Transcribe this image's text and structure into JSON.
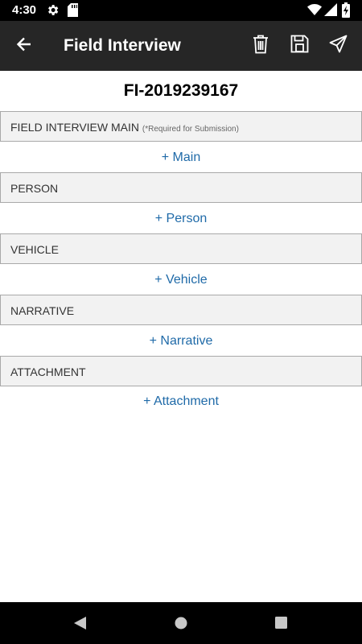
{
  "status_bar": {
    "time": "4:30",
    "icons": [
      "gear-icon",
      "sd-card-icon",
      "wifi-icon",
      "cellular-icon",
      "battery-charging-icon"
    ]
  },
  "app_bar": {
    "title": "Field Interview",
    "actions": [
      "back-arrow-icon",
      "delete-icon",
      "save-icon",
      "send-icon"
    ]
  },
  "record": {
    "id": "FI-2019239167"
  },
  "sections": [
    {
      "header": "FIELD INTERVIEW MAIN",
      "note": "(*Required for Submission)",
      "add_label": "+ Main"
    },
    {
      "header": "PERSON",
      "note": "",
      "add_label": "+ Person"
    },
    {
      "header": "VEHICLE",
      "note": "",
      "add_label": "+ Vehicle"
    },
    {
      "header": "NARRATIVE",
      "note": "",
      "add_label": "+ Narrative"
    },
    {
      "header": "ATTACHMENT",
      "note": "",
      "add_label": "+ Attachment"
    }
  ],
  "colors": {
    "status_bar": "#000000",
    "app_bar": "#262626",
    "link": "#1f6aa8",
    "section_bg": "#f2f2f2",
    "section_border": "#a9a9a9"
  },
  "nav_bar": {
    "buttons": [
      "back-triangle-icon",
      "home-circle-icon",
      "recents-square-icon"
    ]
  }
}
